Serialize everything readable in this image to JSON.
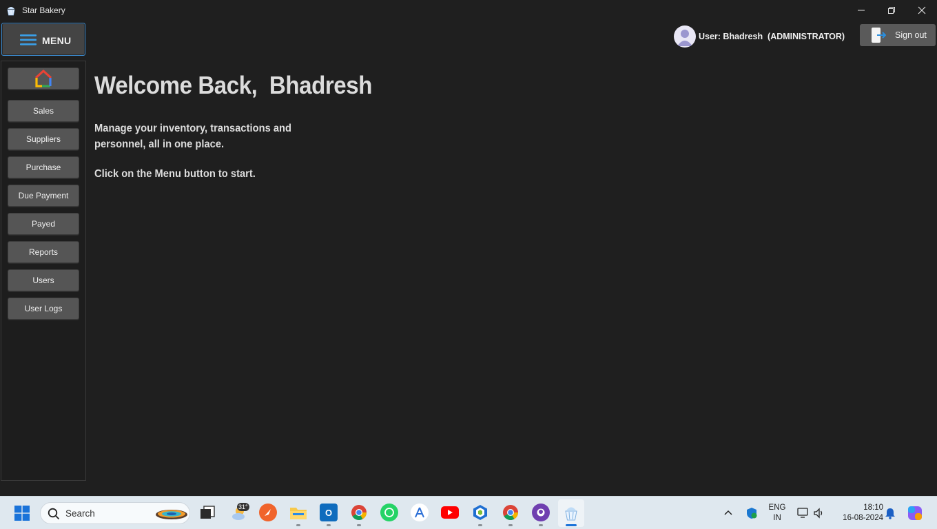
{
  "window": {
    "title": "Star Bakery"
  },
  "header": {
    "menu_label": "MENU",
    "user_label": "User: Bhadresh  (ADMINISTRATOR)",
    "signout_label": "Sign out"
  },
  "sidebar": {
    "items": [
      {
        "label": "Sales"
      },
      {
        "label": "Suppliers"
      },
      {
        "label": "Purchase"
      },
      {
        "label": "Due Payment"
      },
      {
        "label": "Payed"
      },
      {
        "label": "Reports"
      },
      {
        "label": "Users"
      },
      {
        "label": "User Logs"
      }
    ]
  },
  "main": {
    "welcome": "Welcome Back,  Bhadresh",
    "description": "Manage your inventory, transactions and personnel, all in one place.",
    "hint": "Click on the Menu button to start."
  },
  "taskbar": {
    "search_label": "Search",
    "weather_temp": "31°",
    "lang": "ENG",
    "region": "IN",
    "time": "18:10",
    "date": "16-08-2024",
    "icons": [
      "weather-icon",
      "compass-app-icon",
      "file-explorer-icon",
      "outlook-icon",
      "chrome-icon",
      "whatsapp-icon",
      "android-studio-icon",
      "youtube-icon",
      "virtualbox-icon",
      "chrome-profile-icon",
      "github-icon",
      "star-bakery-icon"
    ]
  },
  "colors": {
    "accent": "#3b8bd0",
    "background": "#1f1f1f",
    "button": "#555555"
  }
}
